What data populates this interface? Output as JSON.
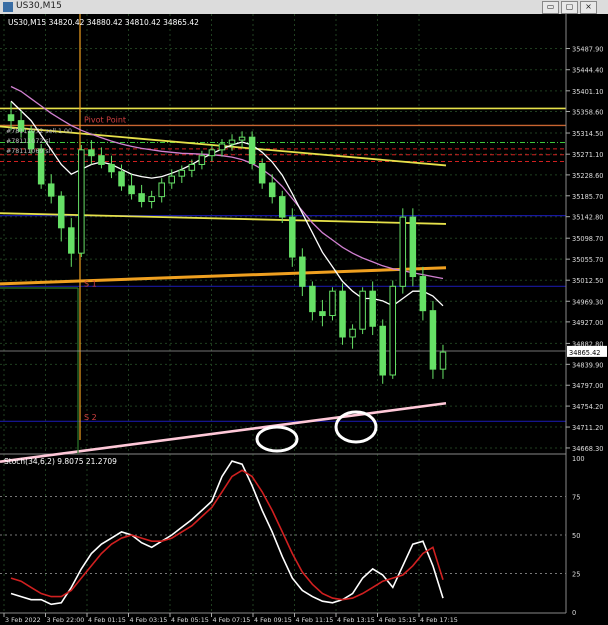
{
  "window": {
    "title": "US30,M15",
    "btn_min": "▭",
    "btn_max": "▢",
    "btn_close": "×"
  },
  "colors": {
    "bg": "#000000",
    "candle": "#66e066",
    "grid": "#1e3a1e",
    "yellow": "#e6e14a",
    "orange": "#f0a020",
    "pink": "#ffc8d8",
    "magenta": "#d080d0",
    "white": "#ffffff",
    "red": "#d02020",
    "blue": "#1818a0",
    "brown": "#c86430"
  },
  "chart_data": [
    {
      "type": "candlestick",
      "title": "US30,M15  34820.42 34880.42 34810.42 34865.42",
      "symbol": "US30",
      "timeframe": "M15",
      "ohlc_last": {
        "open": 34820.42,
        "high": 34880.42,
        "low": 34810.42,
        "close": 34865.42
      },
      "current_price": "34865.42",
      "ylim": [
        34660,
        35530
      ],
      "y_ticks": [
        "35487.90",
        "35444.40",
        "35401.10",
        "35358.60",
        "35314.50",
        "35271.10",
        "35228.60",
        "35185.70",
        "35142.80",
        "35098.70",
        "35055.70",
        "35012.50",
        "34969.30",
        "34927.00",
        "34882.80",
        "34839.90",
        "34797.00",
        "34754.20",
        "34711.20",
        "34668.30"
      ],
      "x_ticks": [
        "3 Feb 2022",
        "3 Feb 22:00",
        "4 Feb 01:15",
        "4 Feb 03:15",
        "4 Feb 05:15",
        "4 Feb 07:15",
        "4 Feb 09:15",
        "4 Feb 11:15",
        "4 Feb 13:15",
        "4 Feb 15:15",
        "4 Feb 17:15"
      ],
      "annotations": [
        {
          "text": "Pivot Point",
          "price": 35330
        },
        {
          "text": "S 1",
          "price": 34993
        },
        {
          "text": "S 2",
          "price": 34720
        }
      ],
      "order_labels": [
        "#78111072 sell 1.00",
        "#78111072 sl",
        "#78111069 sl"
      ],
      "horizontal_levels": [
        {
          "price": 35365,
          "color": "yellow"
        },
        {
          "price": 35330,
          "color": "brown"
        },
        {
          "price": 35295,
          "color": "green-dashdot"
        },
        {
          "price": 35282,
          "color": "red-dash"
        },
        {
          "price": 35270,
          "color": "red-dash"
        },
        {
          "price": 35256,
          "color": "red-dash"
        },
        {
          "price": 35145,
          "color": "blue"
        },
        {
          "price": 35000,
          "color": "blue"
        },
        {
          "price": 34723,
          "color": "blue"
        }
      ],
      "candles": [
        [
          35352,
          35378,
          35320,
          35340
        ],
        [
          35340,
          35360,
          35305,
          35318
        ],
        [
          35318,
          35330,
          35272,
          35282
        ],
        [
          35282,
          35292,
          35200,
          35210
        ],
        [
          35210,
          35230,
          35170,
          35185
        ],
        [
          35185,
          35195,
          35092,
          35120
        ],
        [
          35120,
          35140,
          35040,
          35068
        ],
        [
          35068,
          35290,
          35060,
          35280
        ],
        [
          35280,
          35300,
          35250,
          35268
        ],
        [
          35268,
          35285,
          35242,
          35250
        ],
        [
          35250,
          35268,
          35222,
          35235
        ],
        [
          35235,
          35250,
          35196,
          35206
        ],
        [
          35206,
          35230,
          35178,
          35190
        ],
        [
          35190,
          35208,
          35162,
          35174
        ],
        [
          35174,
          35196,
          35160,
          35184
        ],
        [
          35184,
          35222,
          35172,
          35212
        ],
        [
          35212,
          35240,
          35200,
          35226
        ],
        [
          35226,
          35248,
          35212,
          35238
        ],
        [
          35238,
          35260,
          35224,
          35250
        ],
        [
          35250,
          35278,
          35240,
          35268
        ],
        [
          35268,
          35290,
          35256,
          35280
        ],
        [
          35280,
          35302,
          35266,
          35292
        ],
        [
          35292,
          35312,
          35278,
          35300
        ],
        [
          35300,
          35318,
          35284,
          35306
        ],
        [
          35306,
          35318,
          35240,
          35252
        ],
        [
          35252,
          35262,
          35200,
          35212
        ],
        [
          35212,
          35230,
          35170,
          35184
        ],
        [
          35184,
          35196,
          35130,
          35142
        ],
        [
          35142,
          35160,
          35040,
          35060
        ],
        [
          35060,
          35078,
          34980,
          35000
        ],
        [
          35000,
          35010,
          34930,
          34948
        ],
        [
          34948,
          34972,
          34918,
          34940
        ],
        [
          34940,
          34998,
          34930,
          34990
        ],
        [
          34990,
          35006,
          34880,
          34896
        ],
        [
          34896,
          34922,
          34872,
          34912
        ],
        [
          34912,
          34998,
          34902,
          34990
        ],
        [
          34990,
          35010,
          34900,
          34918
        ],
        [
          34918,
          34932,
          34800,
          34818
        ],
        [
          34818,
          35012,
          34810,
          35000
        ],
        [
          35000,
          35160,
          34985,
          35142
        ],
        [
          35142,
          35160,
          35000,
          35020
        ],
        [
          35020,
          35040,
          34930,
          34950
        ],
        [
          34950,
          34970,
          34810,
          34830
        ],
        [
          34830,
          34880,
          34810,
          34865
        ]
      ],
      "series": [
        {
          "name": "",
          "color": "magenta",
          "values": [
            35410,
            35400,
            35385,
            35370,
            35355,
            35342,
            35330,
            35320,
            35312,
            35305,
            35298,
            35292,
            35287,
            35283,
            35280,
            35277,
            35275,
            35273,
            35272,
            35271,
            35270,
            35268,
            35265,
            35260,
            35252,
            35240,
            35225,
            35205,
            35180,
            35155,
            35130,
            35110,
            35095,
            35080,
            35068,
            35058,
            35050,
            35042,
            35036,
            35032,
            35028,
            35024,
            35020,
            35016
          ]
        },
        {
          "name": "",
          "color": "white",
          "values": [
            35380,
            35360,
            35340,
            35310,
            35280,
            35250,
            35230,
            35240,
            35250,
            35255,
            35250,
            35240,
            35230,
            35225,
            35222,
            35225,
            35232,
            35240,
            35250,
            35262,
            35272,
            35282,
            35290,
            35296,
            35290,
            35275,
            35255,
            35228,
            35190,
            35150,
            35110,
            35070,
            35040,
            35010,
            34990,
            34975,
            34975,
            34970,
            34960,
            34975,
            34990,
            34990,
            34980,
            34960
          ]
        }
      ],
      "moving_levels": [
        {
          "name": "",
          "color": "yellow",
          "start": 35328,
          "end": 35248
        },
        {
          "name": "",
          "color": "yellow",
          "start": 35150,
          "end": 35128
        },
        {
          "name": "",
          "color": "orange",
          "start": 35005,
          "end": 35038
        },
        {
          "name": "",
          "color": "pink",
          "start": 34640,
          "end": 34760
        }
      ]
    },
    {
      "type": "line",
      "title": "Stoch(34,6,2) 9.8075 21.2709",
      "ylim": [
        0,
        100
      ],
      "y_ticks": [
        "100",
        "75",
        "50",
        "25",
        "0"
      ],
      "grid_levels": [
        75,
        50,
        25
      ],
      "series": [
        {
          "name": "%K",
          "color": "white",
          "values": [
            12,
            10,
            8,
            8,
            5,
            6,
            16,
            28,
            38,
            44,
            48,
            52,
            50,
            45,
            42,
            46,
            50,
            55,
            60,
            66,
            72,
            88,
            98,
            96,
            82,
            66,
            52,
            36,
            22,
            14,
            10,
            7,
            6,
            8,
            12,
            22,
            28,
            24,
            16,
            30,
            44,
            46,
            30,
            9
          ]
        },
        {
          "name": "%D",
          "color": "red",
          "values": [
            22,
            20,
            16,
            12,
            10,
            10,
            14,
            22,
            30,
            38,
            44,
            48,
            50,
            48,
            46,
            46,
            48,
            52,
            56,
            62,
            68,
            78,
            88,
            92,
            88,
            78,
            66,
            52,
            38,
            26,
            18,
            12,
            9,
            8,
            9,
            12,
            16,
            20,
            22,
            24,
            30,
            38,
            42,
            21
          ]
        }
      ]
    }
  ]
}
